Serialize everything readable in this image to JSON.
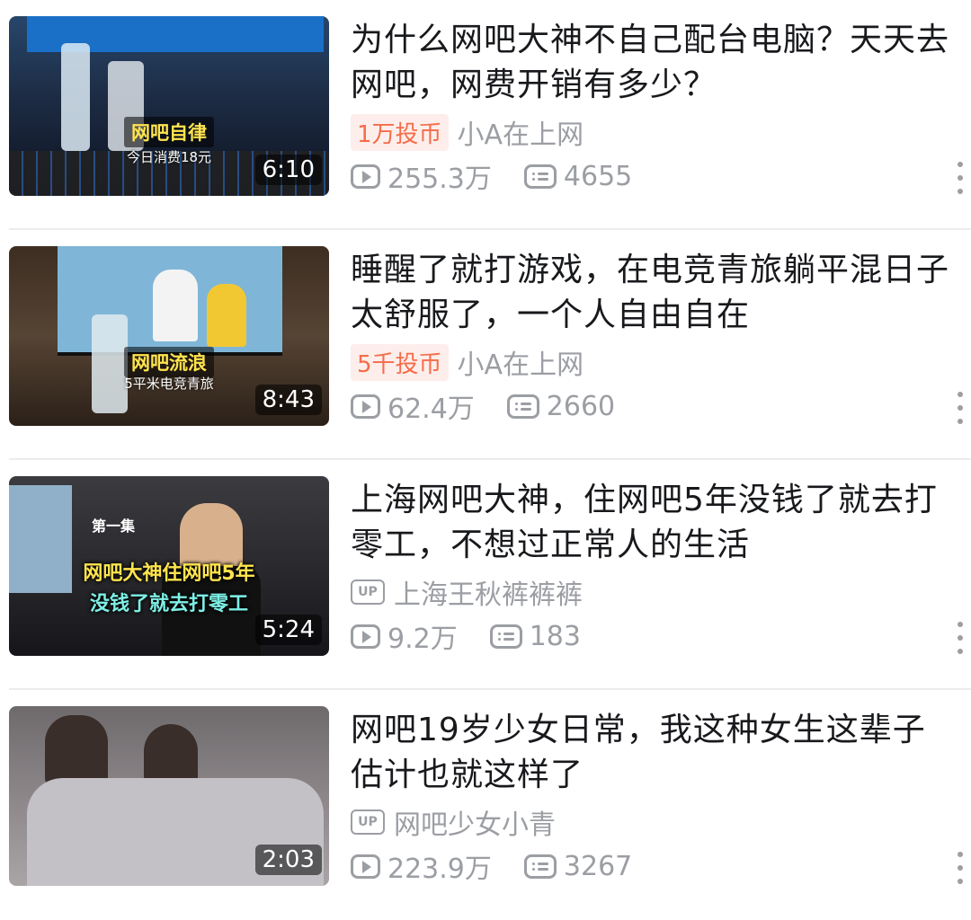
{
  "videos": [
    {
      "title": "为什么网吧大神不自己配台电脑？天天去网吧，网费开销有多少？",
      "badge": "1万投币",
      "author": "小A在上网",
      "views": "255.3万",
      "danmaku": "4655",
      "duration": "6:10",
      "thumb_caption": "网吧自律",
      "thumb_subcaption": "今日消费18元"
    },
    {
      "title": "睡醒了就打游戏，在电竞青旅躺平混日子太舒服了，一个人自由自在",
      "badge": "5千投币",
      "author": "小A在上网",
      "views": "62.4万",
      "danmaku": "2660",
      "duration": "8:43",
      "thumb_caption": "网吧流浪",
      "thumb_subcaption": "5平米电竞青旅"
    },
    {
      "title": "上海网吧大神，住网吧5年没钱了就去打零工，不想过正常人的生活",
      "up_label": "UP",
      "author": "上海王秋裤裤裤",
      "views": "9.2万",
      "danmaku": "183",
      "duration": "5:24",
      "thumb_caption": "网吧大神住网吧5年",
      "thumb_caption2": "没钱了就去打零工",
      "thumb_episode": "第一集"
    },
    {
      "title": "网吧19岁少女日常，我这种女生这辈子估计也就这样了",
      "up_label": "UP",
      "author": "网吧少女小青",
      "views": "223.9万",
      "danmaku": "3267",
      "duration": "2:03"
    }
  ],
  "icons": {
    "views": "play-icon",
    "danmaku": "danmaku-icon",
    "more": "more-vertical-icon",
    "up": "up-badge-icon"
  },
  "colors": {
    "badge_text": "#f56c4a",
    "badge_bg": "#fdeeeb",
    "meta_gray": "#9b9ea3"
  }
}
